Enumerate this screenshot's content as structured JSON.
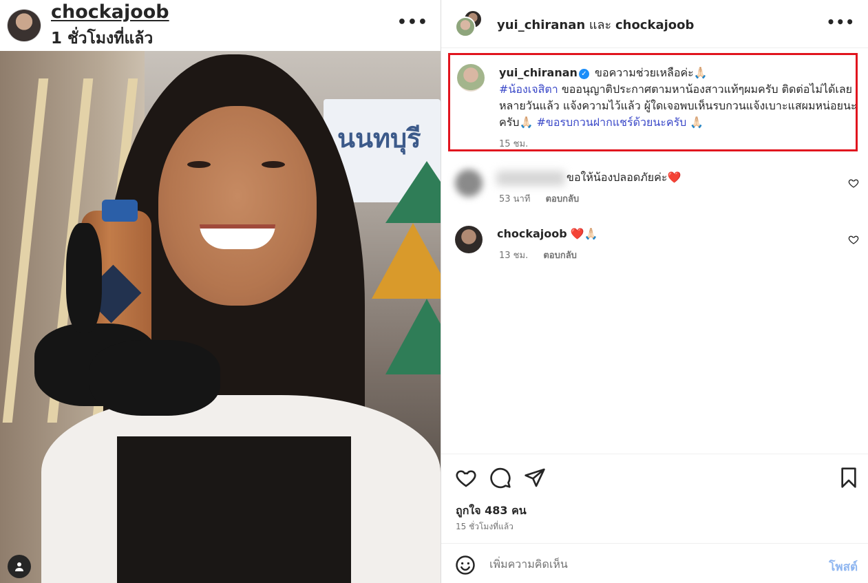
{
  "media": {
    "username": "chockajoob",
    "timestamp": "1 ชั่วโมงที่แล้ว",
    "more_icon": "more-horizontal-icon",
    "photo_sign_text": "นนทบุรี"
  },
  "post": {
    "header": {
      "user1": "yui_chiranan",
      "connector": "และ",
      "user2": "chockajoob",
      "more_icon": "more-horizontal-icon"
    },
    "caption": {
      "username": "yui_chiranan",
      "verified": true,
      "line_part1": "ขอความช่วยเหลือค่ะ🙏🏻",
      "hashtag1": "#น้องเจสิตา",
      "body": " ขออนุญาติประกาศตามหาน้องสาวแท้ๆผมครับ ติดต่อไม่ได้เลยหลายวันแล้ว แจ้งความไว้แล้ว ผู้ใดเจอพบเห็นรบกวนแจ้งเบาะแสผมหน่อยนะครับ🙏🏻 ",
      "hashtag2": "#ขอรบกวนฝากแชร์ด้วยนะครับ",
      "tail": " 🙏🏻",
      "time": "15 ชม."
    },
    "comments": [
      {
        "username": "",
        "username_blurred": true,
        "text": "ขอให้น้องปลอดภัยค่ะ❤️",
        "time": "53 นาที",
        "reply": "ตอบกลับ"
      },
      {
        "username": "chockajoob",
        "username_blurred": false,
        "text": "❤️🙏🏻",
        "time": "13 ชม.",
        "reply": "ตอบกลับ"
      }
    ],
    "actions": {
      "icons": [
        "heart-icon",
        "comment-icon",
        "share-icon",
        "bookmark-icon"
      ]
    },
    "likes": "ถูกใจ 483 คน",
    "post_time": "15 ชั่วโมงที่แล้ว",
    "comment_bar": {
      "placeholder": "เพิ่มความคิดเห็น",
      "post_label": "โพสต์",
      "emoji_icon": "smiley-icon"
    }
  },
  "colors": {
    "highlight_border": "#e1141e",
    "hashtag": "#3a48c8",
    "verified": "#1c8ef9",
    "post_button": "#8fb6f0"
  }
}
